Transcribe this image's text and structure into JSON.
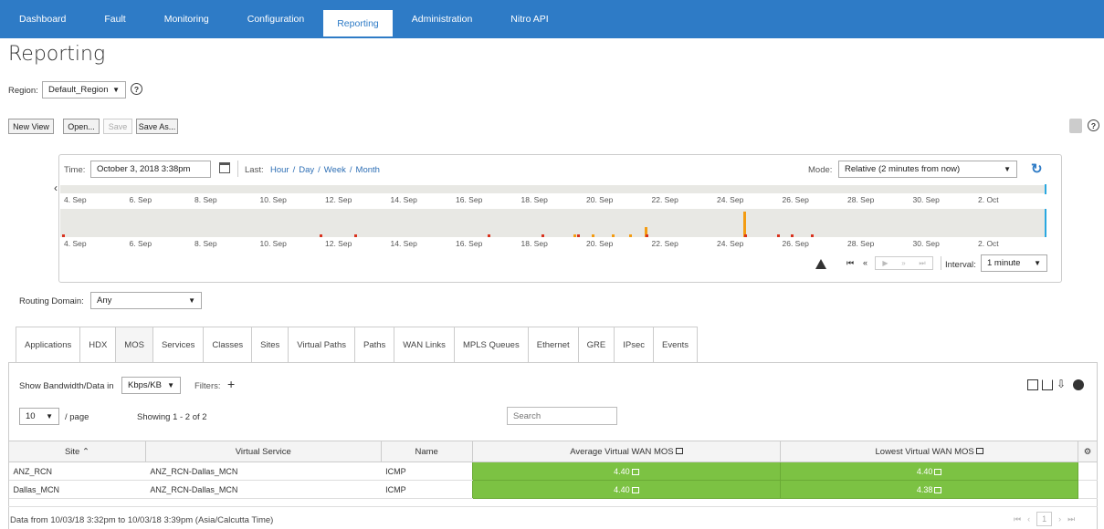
{
  "nav": {
    "tabs": [
      "Dashboard",
      "Fault",
      "Monitoring",
      "Configuration",
      "Reporting",
      "Administration",
      "Nitro API"
    ],
    "active": "Reporting"
  },
  "page": {
    "title": "Reporting"
  },
  "region": {
    "label": "Region:",
    "value": "Default_Region"
  },
  "toolbar": {
    "new_view": "New View",
    "open": "Open...",
    "save": "Save",
    "save_as": "Save As..."
  },
  "timeline": {
    "time_label": "Time:",
    "time_value": "October 3, 2018 3:38pm",
    "last_label": "Last:",
    "last_links": [
      "Hour",
      "Day",
      "Week",
      "Month"
    ],
    "mode_label": "Mode:",
    "mode_value": "Relative (2 minutes from now)",
    "ticks": [
      "4. Sep",
      "6. Sep",
      "8. Sep",
      "10. Sep",
      "12. Sep",
      "14. Sep",
      "16. Sep",
      "18. Sep",
      "20. Sep",
      "22. Sep",
      "24. Sep",
      "26. Sep",
      "28. Sep",
      "30. Sep",
      "2. Oct"
    ],
    "interval_label": "Interval:",
    "interval_value": "1 minute",
    "colors": {
      "alarm_red": "#d9331f",
      "alarm_orange": "#f39c12",
      "cursor": "#29a8e0"
    }
  },
  "routing": {
    "label": "Routing Domain:",
    "value": "Any"
  },
  "report_tabs": [
    "Applications",
    "HDX",
    "MOS",
    "Services",
    "Classes",
    "Sites",
    "Virtual Paths",
    "Paths",
    "WAN Links",
    "MPLS Queues",
    "Ethernet",
    "GRE",
    "IPsec",
    "Events"
  ],
  "report_active": "MOS",
  "controls": {
    "bandwidth_label": "Show Bandwidth/Data in",
    "bandwidth_value": "Kbps/KB",
    "filters_label": "Filters:",
    "per_page_value": "10",
    "per_page_label": "/ page",
    "showing": "Showing 1 - 2 of 2",
    "search_placeholder": "Search"
  },
  "table": {
    "headers": [
      "Site",
      "Virtual Service",
      "Name",
      "Average Virtual WAN MOS",
      "Lowest Virtual WAN MOS"
    ],
    "rows": [
      {
        "site": "ANZ_RCN",
        "service": "ANZ_RCN-Dallas_MCN",
        "name": "ICMP",
        "avg": "4.40",
        "low": "4.40"
      },
      {
        "site": "Dallas_MCN",
        "service": "ANZ_RCN-Dallas_MCN",
        "name": "ICMP",
        "avg": "4.40",
        "low": "4.38"
      }
    ]
  },
  "footer": {
    "range": "Data from 10/03/18 3:32pm to 10/03/18 3:39pm (Asia/Calcutta Time)",
    "page": "1"
  },
  "accent": "#2e7bc6",
  "mos_good": "#7cc243"
}
